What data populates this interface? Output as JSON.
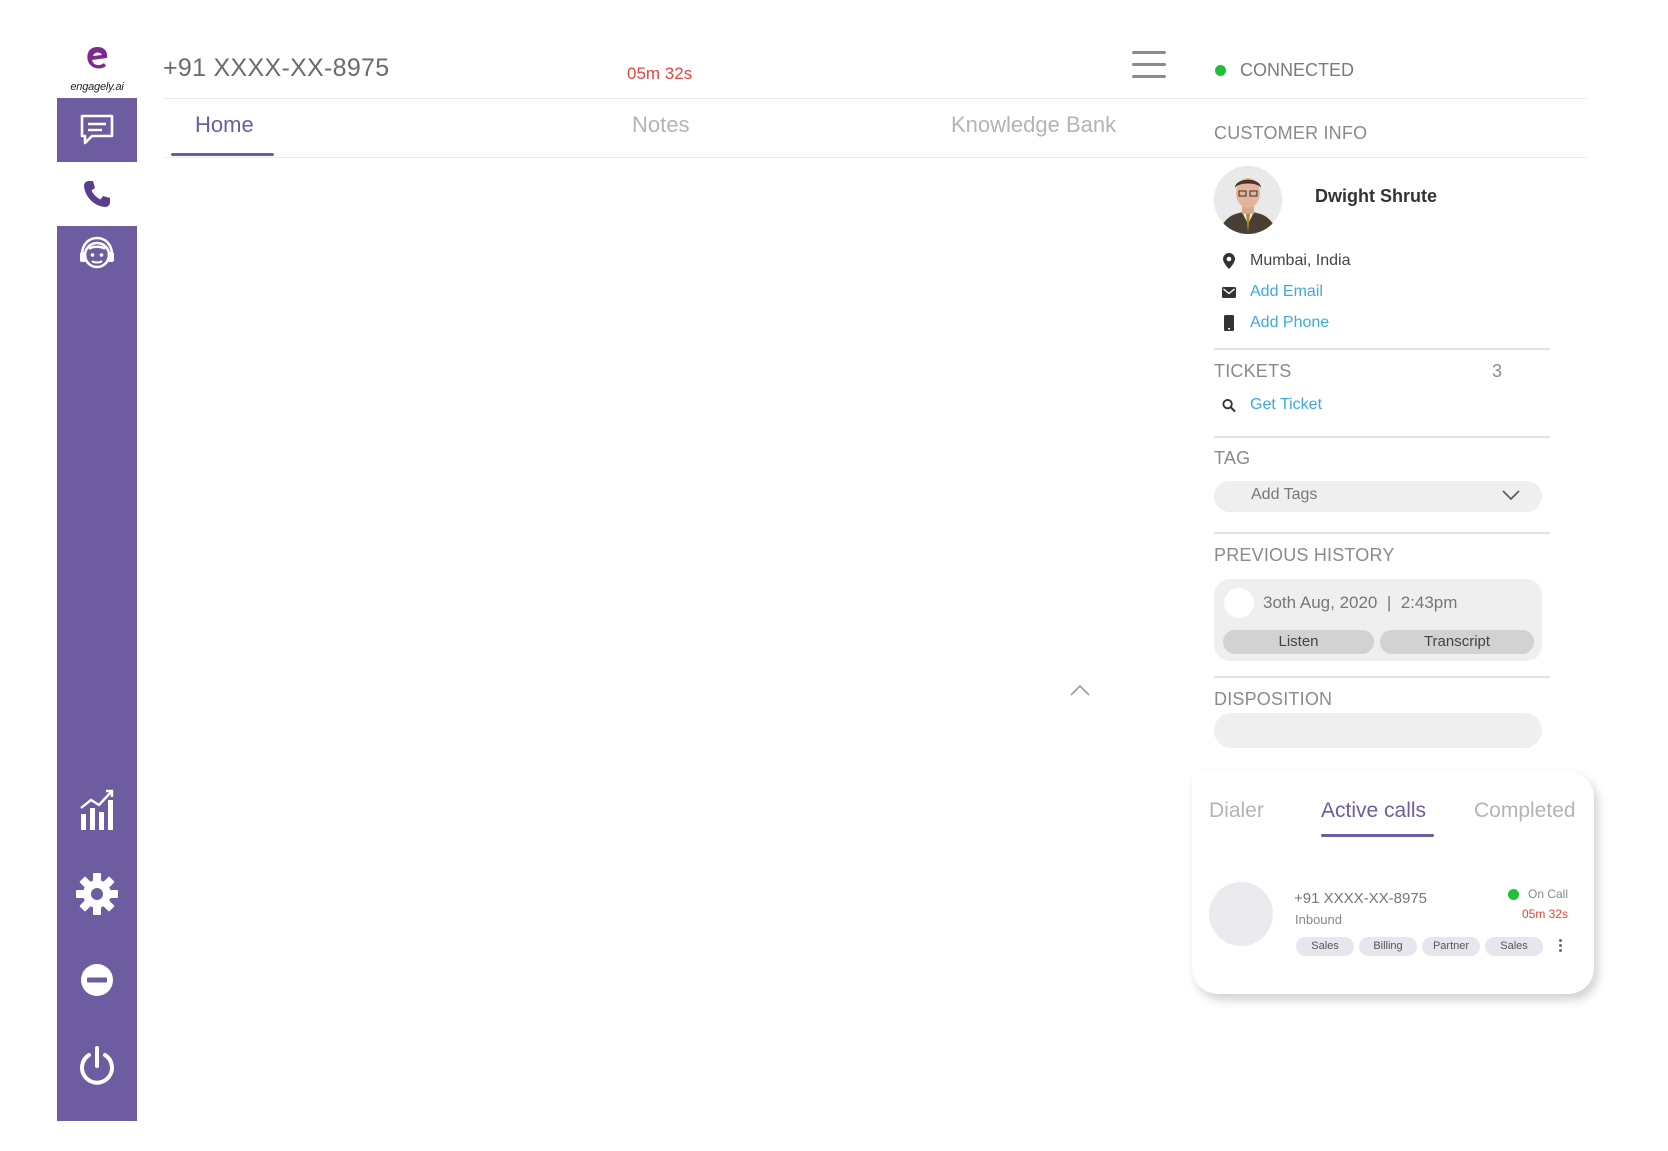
{
  "app": {
    "brand": "engagely.ai"
  },
  "nav": {
    "items": [
      {
        "icon": "chat-icon",
        "active": false
      },
      {
        "icon": "phone-icon",
        "active": true
      },
      {
        "icon": "agent-headset-icon",
        "active": false
      },
      {
        "icon": "analytics-icon",
        "active": false
      },
      {
        "icon": "settings-icon",
        "active": false
      },
      {
        "icon": "do-not-disturb-icon",
        "active": false
      },
      {
        "icon": "power-icon",
        "active": false
      }
    ]
  },
  "header": {
    "phone": "+91 XXXX-XX-8975",
    "timer": "05m 32s",
    "status": "CONNECTED",
    "status_color": "#1fbf3a"
  },
  "tabs": {
    "home": "Home",
    "notes": "Notes",
    "knowledge": "Knowledge Bank",
    "active": "Home"
  },
  "customer": {
    "section_title": "CUSTOMER INFO",
    "name": "Dwight Shrute",
    "location": "Mumbai, India",
    "add_email": "Add Email",
    "add_phone": "Add Phone"
  },
  "tickets": {
    "title": "TICKETS",
    "count": "3",
    "get_ticket": "Get Ticket"
  },
  "tag": {
    "title": "TAG",
    "placeholder": "Add Tags"
  },
  "history": {
    "title": "PREVIOUS HISTORY",
    "entry": {
      "date": "3oth Aug, 2020",
      "time": "2:43pm",
      "listen": "Listen",
      "transcript": "Transcript"
    }
  },
  "disposition": {
    "title": "DISPOSITION",
    "value": ""
  },
  "calls_panel": {
    "tabs": [
      "Dialer",
      "Active calls",
      "Completed"
    ],
    "active_tab": "Active calls",
    "call": {
      "number": "+91 XXXX-XX-8975",
      "direction": "Inbound",
      "status": "On Call",
      "timer": "05m 32s",
      "tags": [
        "Sales",
        "Billing",
        "Partner",
        "Sales"
      ]
    }
  },
  "colors": {
    "accent": "#6e5ca0",
    "link": "#3fa9d8",
    "timer": "#e0453a",
    "online": "#1fbf3a"
  }
}
